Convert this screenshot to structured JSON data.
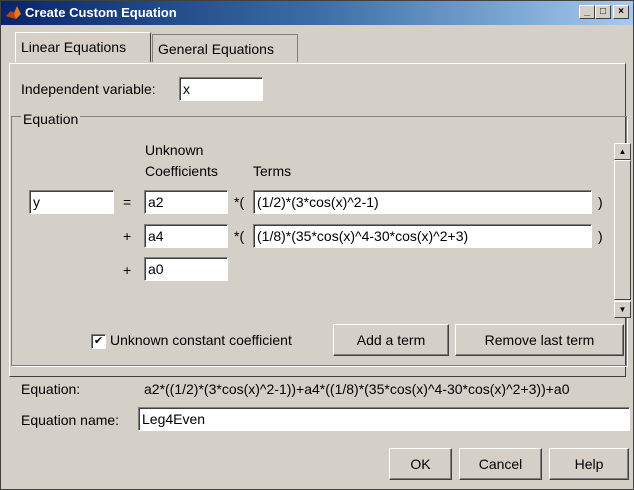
{
  "window": {
    "title": "Create Custom Equation",
    "minimize": "_",
    "maximize": "□",
    "close": "×"
  },
  "tabs": [
    "Linear Equations",
    "General Equations"
  ],
  "independent": {
    "label": "Independent variable:",
    "value": "x"
  },
  "equation_group": {
    "title": "Equation",
    "col_coefficients_1": "Unknown",
    "col_coefficients_2": "Coefficients",
    "col_terms": "Terms",
    "lhs": "y",
    "rows": [
      {
        "op": "=",
        "coef": "a2",
        "mult": "*(",
        "term": "(1/2)*(3*cos(x)^2-1)",
        "close": ")"
      },
      {
        "op": "+",
        "coef": "a4",
        "mult": "*(",
        "term": "(1/8)*(35*cos(x)^4-30*cos(x)^2+3)",
        "close": ")"
      },
      {
        "op": "+",
        "coef": "a0"
      }
    ],
    "constant_checkbox": {
      "label": "Unknown constant coefficient",
      "checked": true
    },
    "add_term": "Add a term",
    "remove_term": "Remove last term"
  },
  "equation_preview": {
    "label": "Equation:",
    "value": "a2*((1/2)*(3*cos(x)^2-1))+a4*((1/8)*(35*cos(x)^4-30*cos(x)^2+3))+a0"
  },
  "equation_name": {
    "label": "Equation name:",
    "value": "Leg4Even"
  },
  "buttons": {
    "ok": "OK",
    "cancel": "Cancel",
    "help": "Help"
  },
  "colors": {
    "face": "#d4d0c8",
    "title_start": "#0a246a",
    "title_end": "#a6caf0"
  }
}
